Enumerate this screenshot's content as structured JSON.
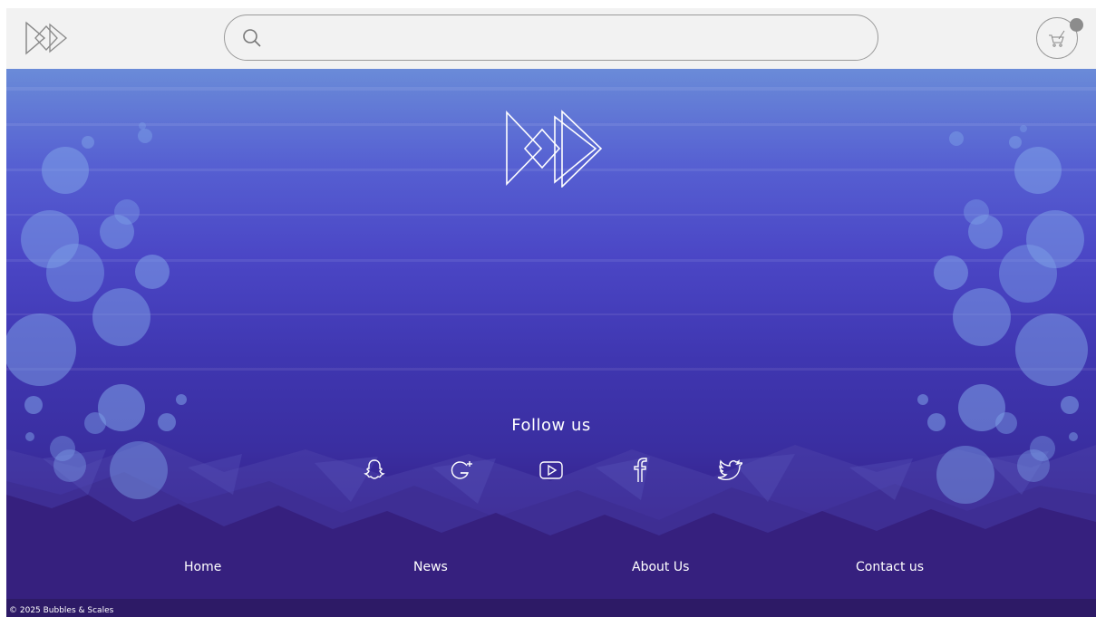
{
  "header": {
    "logo_icon": "double-triangle-logo-icon",
    "search": {
      "placeholder": "",
      "value": "",
      "icon": "search-icon"
    },
    "cart_icon": "cart-icon"
  },
  "hero": {
    "logo_icon": "double-triangle-logo-icon",
    "follow_label": "Follow us",
    "social": [
      {
        "name": "snapchat",
        "icon": "snapchat-icon"
      },
      {
        "name": "google-plus",
        "icon": "google-plus-icon"
      },
      {
        "name": "youtube",
        "icon": "youtube-icon"
      },
      {
        "name": "facebook",
        "icon": "facebook-icon"
      },
      {
        "name": "twitter",
        "icon": "twitter-icon"
      }
    ]
  },
  "nav": {
    "home": "Home",
    "news": "News",
    "about": "About Us",
    "contact": "Contact us"
  },
  "footer": {
    "copyright": "© 2025 Bubbles & Scales"
  },
  "colors": {
    "header_bg": "#f2f2f2",
    "hero_top": "#6a8bd8",
    "hero_mid": "#4b47c6",
    "hero_bottom": "#331a78",
    "footer_bg": "#2d1a66",
    "bubble": "#7fa3e8"
  }
}
